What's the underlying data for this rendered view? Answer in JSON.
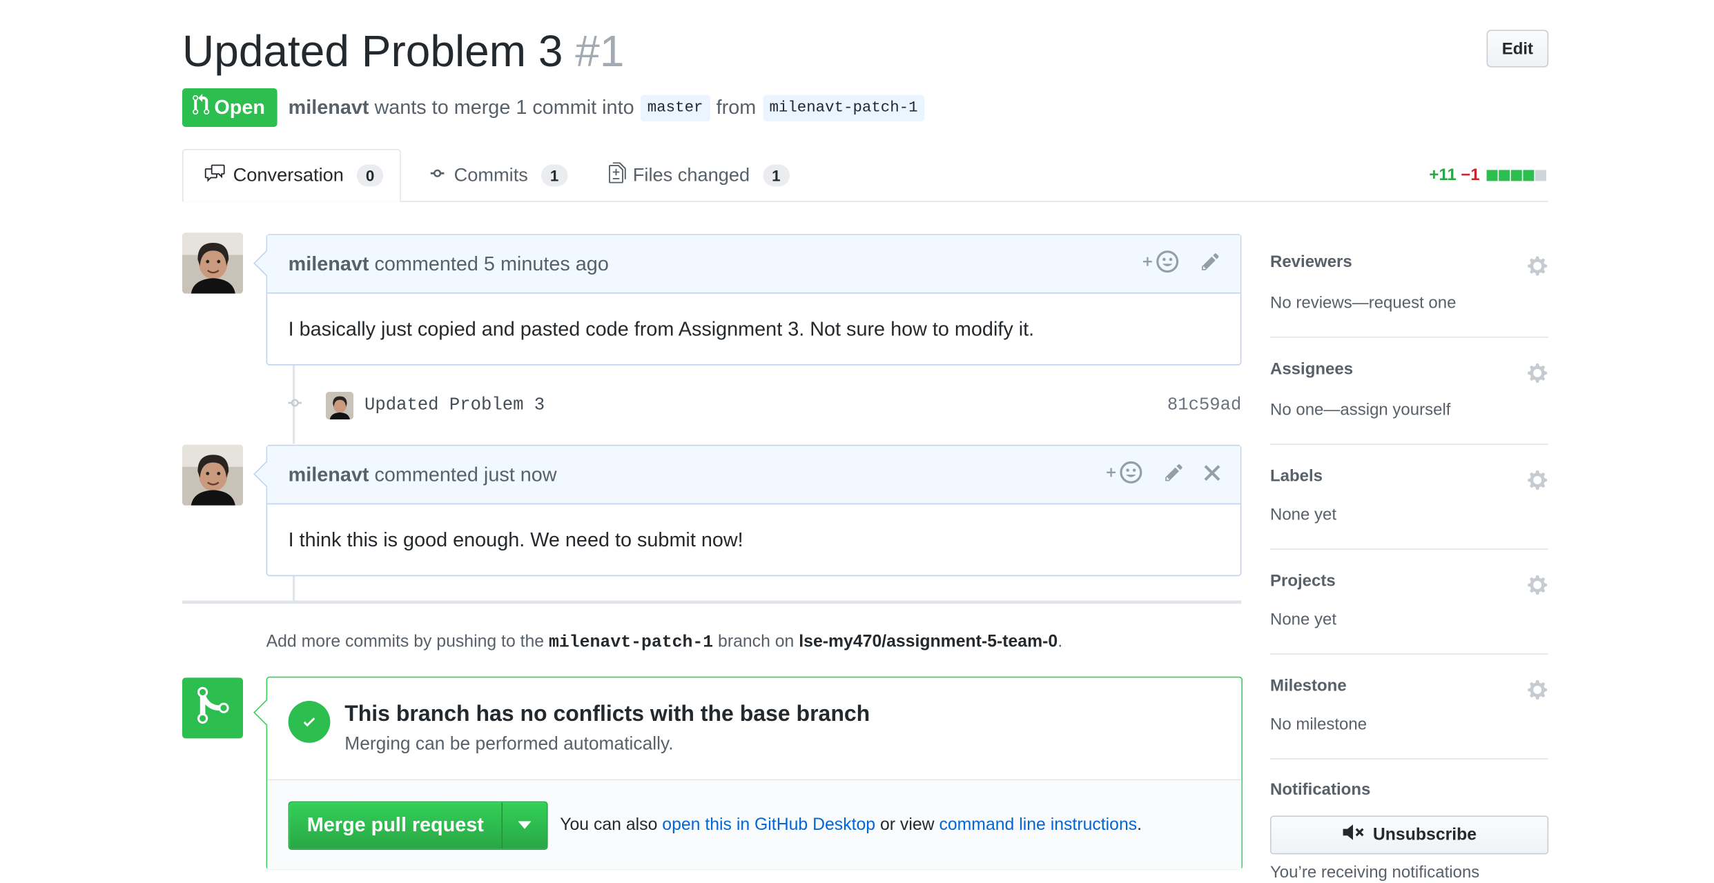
{
  "header": {
    "title": "Updated Problem 3",
    "number": "#1",
    "edit_label": "Edit",
    "state_label": "Open",
    "author": "milenavt",
    "merge_text": "wants to merge 1 commit into",
    "base_branch": "master",
    "from_text": "from",
    "head_branch": "milenavt-patch-1"
  },
  "tabs": [
    {
      "label": "Conversation",
      "count": "0"
    },
    {
      "label": "Commits",
      "count": "1"
    },
    {
      "label": "Files changed",
      "count": "1"
    }
  ],
  "diffstat": {
    "additions": "+11",
    "deletions": "−1"
  },
  "timeline": {
    "comment1": {
      "author": "milenavt",
      "meta": "commented 5 minutes ago",
      "body": "I basically just copied and pasted code from Assignment 3. Not sure how to modify it."
    },
    "commit": {
      "message": "Updated Problem 3",
      "sha": "81c59ad"
    },
    "comment2": {
      "author": "milenavt",
      "meta": "commented just now",
      "body": "I think this is good enough. We need to submit now!"
    }
  },
  "push_note": {
    "prefix": "Add more commits by pushing to the",
    "branch": "milenavt-patch-1",
    "middle": "branch on",
    "repo": "lse-my470/assignment-5-team-0",
    "suffix": "."
  },
  "merge_box": {
    "title": "This branch has no conflicts with the base branch",
    "subtitle": "Merging can be performed automatically.",
    "merge_button": "Merge pull request",
    "also_prefix": "You can also",
    "desktop_link": "open this in GitHub Desktop",
    "or_view": "or view",
    "cli_link": "command line instructions",
    "period": "."
  },
  "sidebar": {
    "reviewers": {
      "title": "Reviewers",
      "value": "No reviews—request one"
    },
    "assignees": {
      "title": "Assignees",
      "value": "No one—assign yourself"
    },
    "labels": {
      "title": "Labels",
      "value": "None yet"
    },
    "projects": {
      "title": "Projects",
      "value": "None yet"
    },
    "milestone": {
      "title": "Milestone",
      "value": "No milestone"
    },
    "notifications": {
      "title": "Notifications",
      "unsubscribe": "Unsubscribe",
      "note": "You’re receiving notifications"
    }
  },
  "colors": {
    "open_green": "#2cbe4e",
    "link_blue": "#0366d6",
    "add_green": "#28a745",
    "del_red": "#cb2431"
  }
}
